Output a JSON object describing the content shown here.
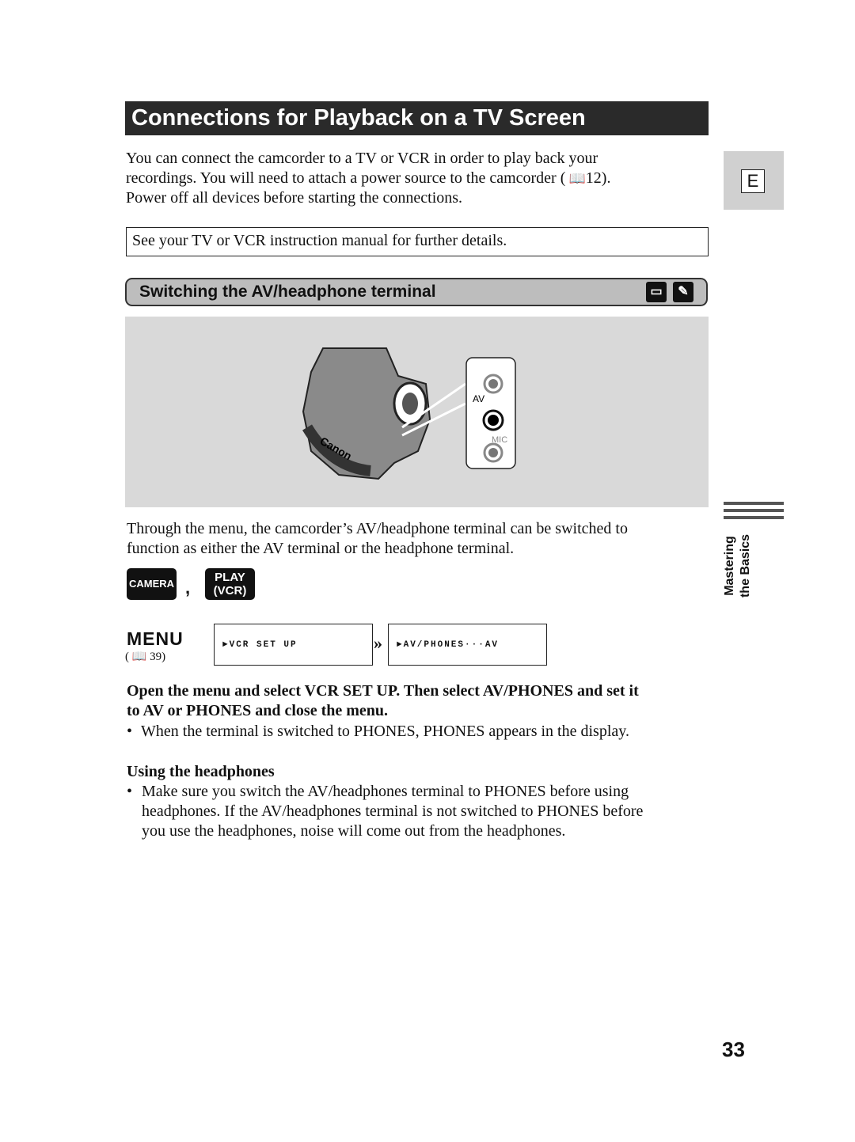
{
  "title": "Connections for Playback on a TV Screen",
  "intro": [
    "You can connect the camcorder to a TV or VCR in order to play back your",
    "recordings. You will need to attach a power source to the camcorder (",
    "12).",
    "Power off all devices before starting the connections."
  ],
  "note": "See your TV or VCR instruction manual for further details.",
  "side_tab": {
    "letter": "E",
    "section_line1": "Mastering",
    "section_line2": "the Basics"
  },
  "section": {
    "title": "Switching the AV/headphone terminal",
    "icons": [
      "camera-mode-icon",
      "remote-control-icon"
    ]
  },
  "illustration": {
    "brand": "Canon",
    "jack_labels": [
      "AV",
      "MIC"
    ]
  },
  "body1": [
    "Through the menu, the camcorder’s AV/headphone terminal can be switched to",
    "function as either the AV terminal or the headphone terminal."
  ],
  "modes": {
    "camera": "CAMERA",
    "separator": ",",
    "play_line1": "PLAY",
    "play_line2": "(VCR)"
  },
  "menu": {
    "label": "MENU",
    "ref": "39",
    "step1": "►VCR SET UP",
    "step2": "►AV/PHONES···AV"
  },
  "instruction": [
    "Open the menu and select VCR SET UP. Then select AV/PHONES and set it",
    "to AV or PHONES and close the menu."
  ],
  "bullet1": "When the terminal is switched to PHONES, PHONES appears in the display.",
  "headphones": {
    "heading": "Using the headphones",
    "lines": [
      "Make sure you switch the AV/headphones terminal to PHONES before using",
      "headphones. If the AV/headphones terminal is not switched to PHONES before",
      "you use the headphones, noise will come out from the headphones."
    ]
  },
  "page_number": "33"
}
